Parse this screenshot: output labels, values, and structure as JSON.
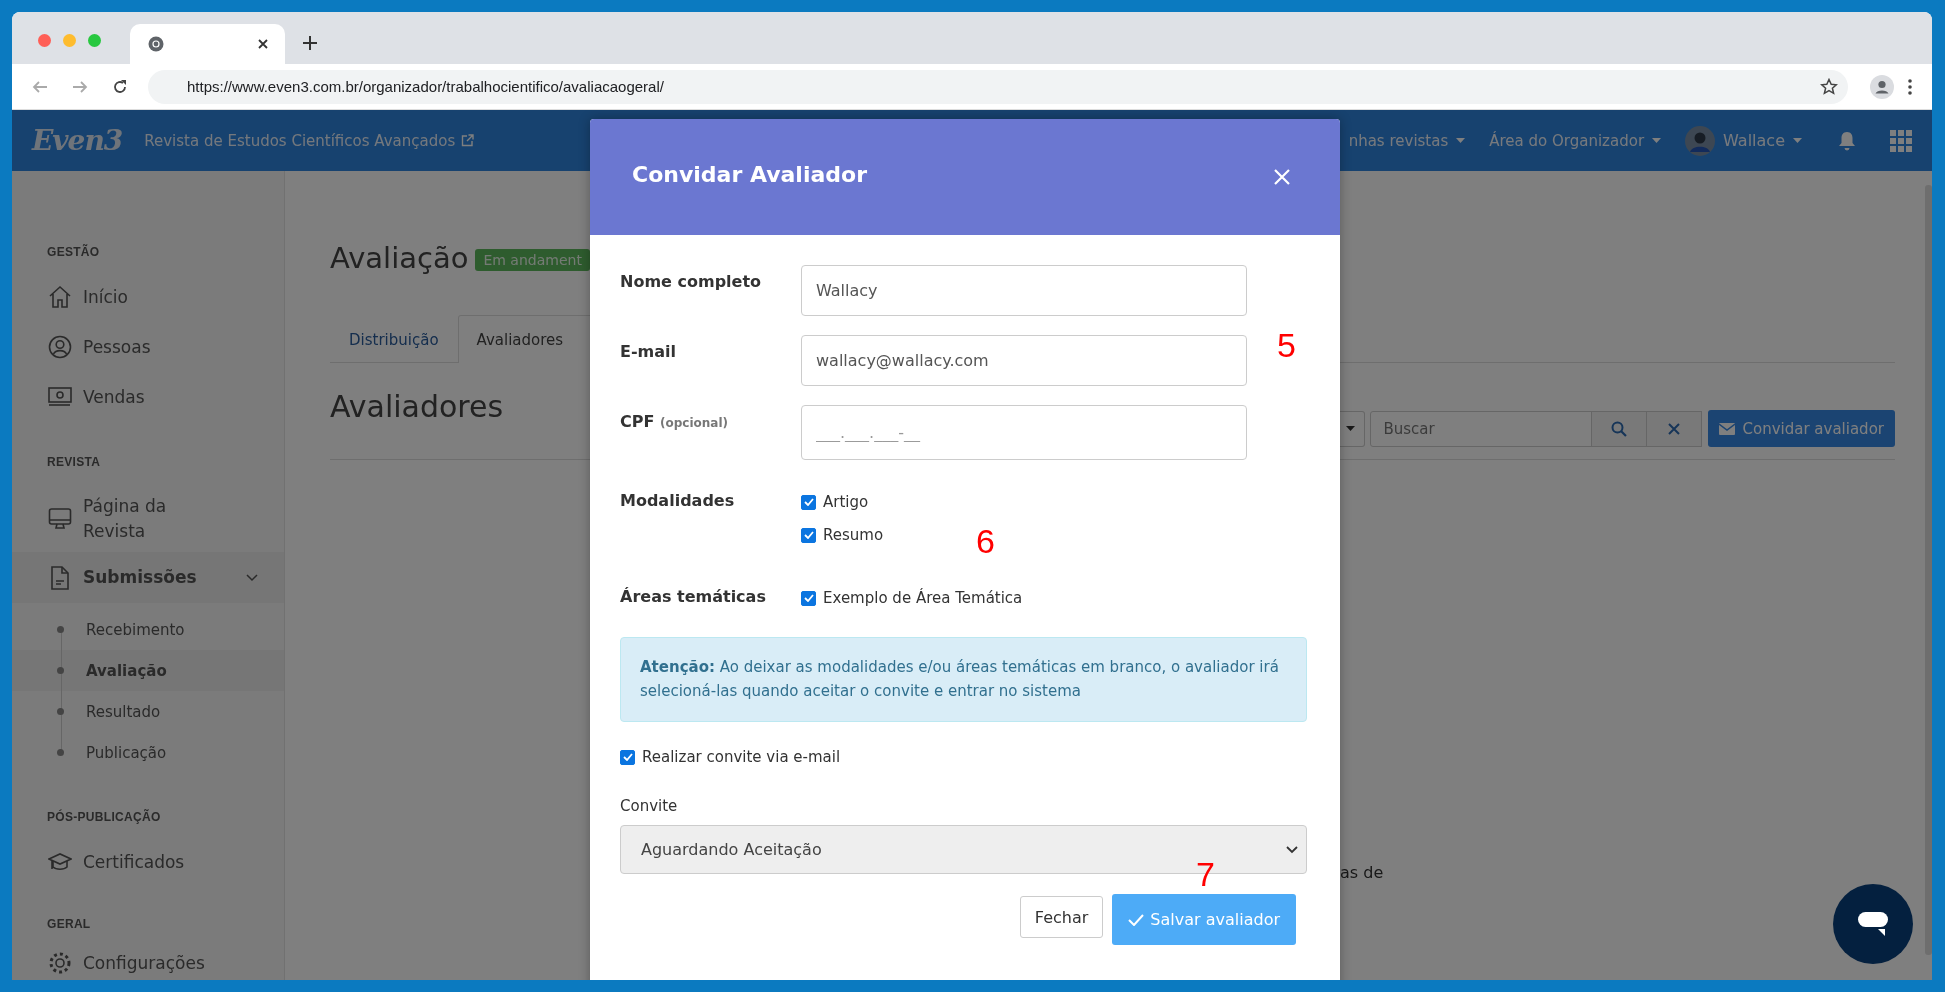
{
  "browser": {
    "url": "https://www.even3.com.br/organizador/trabalhocientifico/avaliacaogeral/"
  },
  "app_bar": {
    "logo": "Even3",
    "journal_title": "Revista de Estudos Científicos Avançados",
    "menus": [
      {
        "label": "nhas revistas"
      },
      {
        "label": "Área do Organizador"
      }
    ],
    "user": "Wallace"
  },
  "sidebar": {
    "sections": [
      {
        "heading": "GESTÃO",
        "items": [
          {
            "label": "Início",
            "selected": false
          },
          {
            "label": "Pessoas",
            "selected": false
          },
          {
            "label": "Vendas",
            "selected": false
          }
        ]
      },
      {
        "heading": "REVISTA",
        "items": [
          {
            "label": "Página da Revista",
            "selected": false
          },
          {
            "label": "Submissões",
            "selected": true,
            "expanded": true,
            "children": [
              {
                "label": "Recebimento",
                "selected": false
              },
              {
                "label": "Avaliação",
                "selected": true
              },
              {
                "label": "Resultado",
                "selected": false
              },
              {
                "label": "Publicação",
                "selected": false
              }
            ]
          }
        ]
      },
      {
        "heading": "PÓS-PUBLICAÇÃO",
        "items": [
          {
            "label": "Certificados",
            "selected": false
          }
        ]
      },
      {
        "heading": "GERAL",
        "items": [
          {
            "label": "Configurações",
            "selected": false
          }
        ]
      }
    ]
  },
  "page": {
    "title": "Avaliação",
    "status_badge": "Em andament",
    "tabs": [
      {
        "label": "Distribuição",
        "selected": false
      },
      {
        "label": "Avaliadores",
        "selected": true
      }
    ],
    "section_title": "Avaliadores",
    "search": {
      "placeholder": "Buscar"
    },
    "invite_button": "Convidar avaliador",
    "text_fragment": "as de"
  },
  "modal": {
    "title": "Convidar Avaliador",
    "fields": [
      {
        "label": "Nome completo",
        "value": "Wallacy"
      },
      {
        "label": "E-mail",
        "value": "wallacy@wallacy.com"
      },
      {
        "label": "CPF",
        "hint": "(opcional)",
        "placeholder": "___.___.___-__"
      }
    ],
    "modalidades": {
      "label": "Modalidades",
      "options": [
        {
          "label": "Artigo",
          "checked": true
        },
        {
          "label": "Resumo",
          "checked": true
        }
      ]
    },
    "areas": {
      "label": "Áreas temáticas",
      "options": [
        {
          "label": "Exemplo de Área Temática",
          "checked": true
        }
      ]
    },
    "alert": "**Atenção:** Ao deixar as modalidades e/ou áreas temáticas em branco, o avaliador irá selecioná-las quando aceitar o convite e entrar no sistema",
    "email_invite": {
      "label": "Realizar convite via e-mail",
      "checked": true
    },
    "convite": {
      "label": "Convite",
      "value": "Aguardando Aceitação"
    },
    "buttons": [
      {
        "label": "Fechar",
        "kind": "secondary"
      },
      {
        "label": "Salvar avaliador",
        "kind": "primary"
      }
    ]
  },
  "annotations": [
    "5",
    "6",
    "7"
  ]
}
